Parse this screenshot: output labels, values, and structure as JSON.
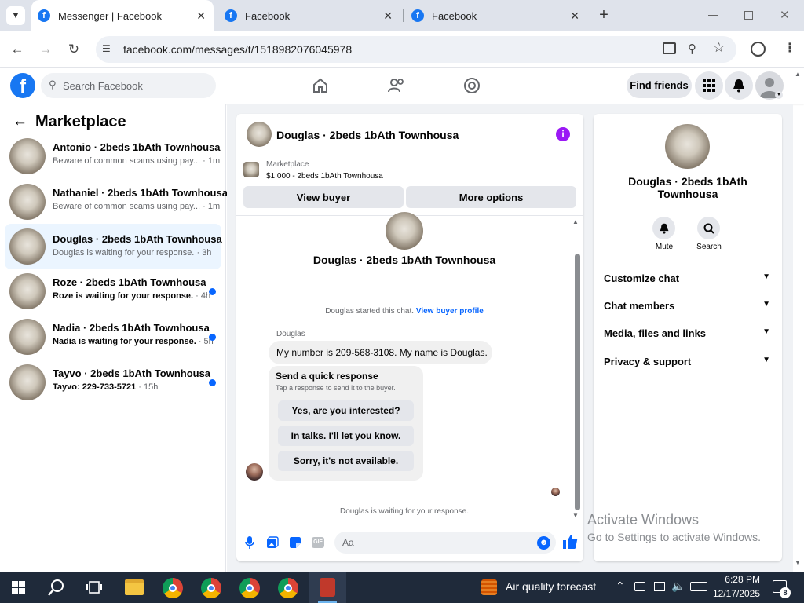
{
  "browser": {
    "tabs": [
      {
        "title": "Messenger | Facebook",
        "active": true
      },
      {
        "title": "Facebook",
        "active": false
      },
      {
        "title": "Facebook",
        "active": false
      }
    ],
    "url": "facebook.com/messages/t/1518982076045978"
  },
  "fb_header": {
    "search_placeholder": "Search Facebook",
    "find_friends": "Find friends"
  },
  "left": {
    "title": "Marketplace",
    "conversations": [
      {
        "name": "Antonio · 2beds 1bAth Townhousa",
        "preview": "Beware of common scams using pay...",
        "time": "· 1m",
        "unread": false,
        "selected": false
      },
      {
        "name": "Nathaniel · 2beds 1bAth Townhousa",
        "preview": "Beware of common scams using pay...",
        "time": "· 1m",
        "unread": false,
        "selected": false
      },
      {
        "name": "Douglas · 2beds 1bAth Townhousa",
        "preview": "Douglas is waiting for your response.",
        "time": "· 3h",
        "unread": false,
        "selected": true
      },
      {
        "name": "Roze · 2beds 1bAth Townhousa",
        "preview": "Roze is waiting for your response.",
        "time": "· 4h",
        "unread": true,
        "selected": false
      },
      {
        "name": "Nadia · 2beds 1bAth Townhousa",
        "preview": "Nadia is waiting for your response.",
        "time": "· 5h",
        "unread": true,
        "selected": false
      },
      {
        "name": "Tayvo · 2beds 1bAth Townhousa",
        "preview": "Tayvo: 229-733-5721",
        "time": "· 15h",
        "unread": true,
        "selected": false
      }
    ]
  },
  "chat": {
    "header_title": "Douglas · 2beds 1bAth Townhousa",
    "listing_source": "Marketplace",
    "listing_detail": "$1,000 - 2beds 1bAth Townhousa",
    "view_buyer": "View buyer",
    "more_options": "More options",
    "profile_name": "Douglas · 2beds 1bAth Townhousa",
    "started_text": "Douglas started this chat.",
    "view_buyer_profile": "View buyer profile",
    "sender_label": "Douglas",
    "message": "My number is 209-568-3108. My name is Douglas.",
    "quick_title": "Send a quick response",
    "quick_sub": "Tap a response to send it to the buyer.",
    "quick_replies": [
      "Yes, are you interested?",
      "In talks. I'll let you know.",
      "Sorry, it's not available."
    ],
    "waiting_text": "Douglas is waiting for your response.",
    "composer_placeholder": "Aa"
  },
  "right": {
    "name_line1": "Douglas · 2beds 1bAth",
    "name_line2": "Townhousa",
    "mute": "Mute",
    "search": "Search",
    "menu": [
      "Customize chat",
      "Chat members",
      "Media, files and links",
      "Privacy & support"
    ]
  },
  "watermark": {
    "line1": "Activate Windows",
    "line2": "Go to Settings to activate Windows."
  },
  "taskbar": {
    "weather": "Air quality forecast",
    "time": "6:28 PM",
    "date": "12/17/2025",
    "notif_count": "8"
  },
  "colors": {
    "fb_blue": "#1877f2",
    "link_blue": "#0866ff",
    "selected_bg": "#ebf5ff"
  }
}
